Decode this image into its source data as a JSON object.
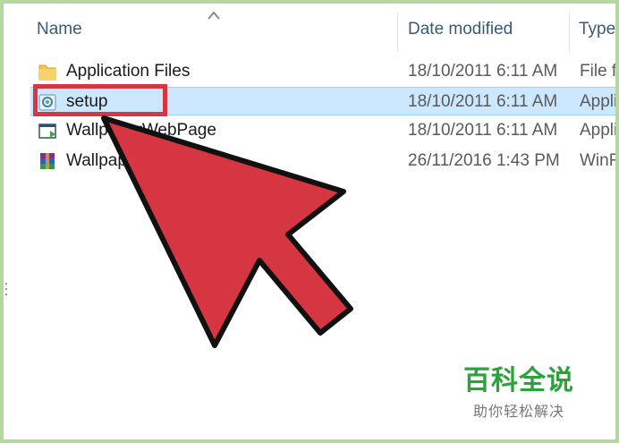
{
  "header": {
    "sort_indicator": "^",
    "columns": [
      {
        "label": "Name"
      },
      {
        "label": "Date modified"
      },
      {
        "label": "Type"
      }
    ]
  },
  "files": [
    {
      "name": "Application Files",
      "date": "18/10/2011 6:11 AM",
      "type": "File folder",
      "icon": "folder-icon",
      "selected": false
    },
    {
      "name": "setup",
      "date": "18/10/2011 6:11 AM",
      "type": "Application",
      "icon": "setup-app-icon",
      "selected": true
    },
    {
      "name": "WallpaperWebPage",
      "date": "18/10/2011 6:11 AM",
      "type": "Application",
      "icon": "webpage-app-icon",
      "selected": false
    },
    {
      "name": "Wallpaper",
      "date": "26/11/2016 1:43 PM",
      "type": "WinRAR archive",
      "icon": "winrar-archive-icon",
      "selected": false
    }
  ],
  "watermark": {
    "title": "百科全说",
    "subtitle": "助你轻松解决"
  },
  "colors": {
    "selection": "#cce8ff",
    "annotation_red": "#d53642",
    "frame_border": "#b7d7a2",
    "watermark_green": "#2aa33a"
  }
}
